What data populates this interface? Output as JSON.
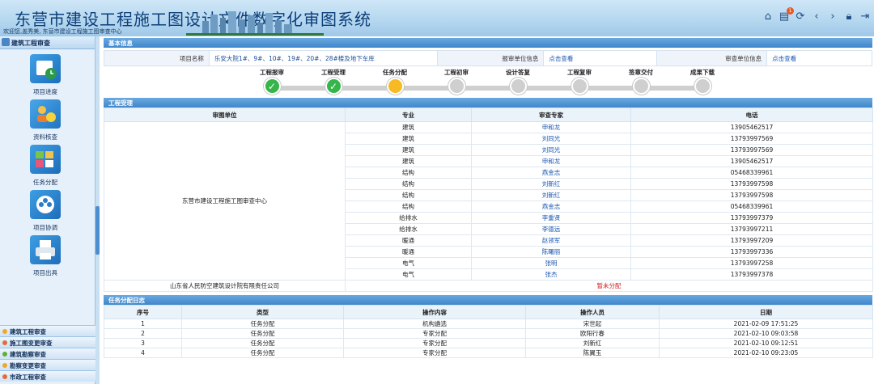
{
  "header": {
    "title": "东营市建设工程施工图设计文件数字化审图系统",
    "welcome": "欢迎您,盖秀美, 东营市建设工程施工图审查中心",
    "badge_count": "1"
  },
  "sidebar": {
    "head": "建筑工程审查",
    "items": [
      {
        "label": "项目进度",
        "icon": "calendar-clock-icon"
      },
      {
        "label": "资料核查",
        "icon": "people-check-icon"
      },
      {
        "label": "任务分配",
        "icon": "task-assign-icon"
      },
      {
        "label": "项目协调",
        "icon": "coordination-icon"
      },
      {
        "label": "项目出具",
        "icon": "printer-icon"
      }
    ],
    "bottom": [
      "建筑工程审查",
      "施工图变更审查",
      "建筑勘察审查",
      "勘察变更审查",
      "市政工程审查"
    ]
  },
  "basic": {
    "section": "基本信息",
    "project_name_label": "项目名称",
    "project_name": "乐安大院1#、9#、10#、19#、20#、28#楼及地下车库",
    "report_unit_label": "报审单位信息",
    "report_unit_link": "点击查看",
    "review_unit_label": "审查单位信息",
    "review_unit_link": "点击查看"
  },
  "steps": [
    {
      "name": "工程报审",
      "status": "done"
    },
    {
      "name": "工程受理",
      "status": "done"
    },
    {
      "name": "任务分配",
      "status": "current"
    },
    {
      "name": "工程初审",
      "status": "pending"
    },
    {
      "name": "设计答复",
      "status": "pending"
    },
    {
      "name": "工程复审",
      "status": "pending"
    },
    {
      "name": "签章交付",
      "status": "pending"
    },
    {
      "name": "成果下载",
      "status": "pending"
    }
  ],
  "acceptance": {
    "section": "工程受理",
    "headers": [
      "审图单位",
      "专业",
      "审查专家",
      "电话"
    ],
    "unit": "东营市建设工程施工图审查中心",
    "rows": [
      {
        "major": "建筑",
        "expert": "申和龙",
        "phone": "13905462517"
      },
      {
        "major": "建筑",
        "expert": "刘同光",
        "phone": "13793997569"
      },
      {
        "major": "建筑",
        "expert": "刘同光",
        "phone": "13793997569"
      },
      {
        "major": "建筑",
        "expert": "申和龙",
        "phone": "13905462517"
      },
      {
        "major": "结构",
        "expert": "燕金志",
        "phone": "05468339961"
      },
      {
        "major": "结构",
        "expert": "刘新红",
        "phone": "13793997598"
      },
      {
        "major": "结构",
        "expert": "刘新红",
        "phone": "13793997598"
      },
      {
        "major": "结构",
        "expert": "燕金志",
        "phone": "05468339961"
      },
      {
        "major": "给排水",
        "expert": "李重贤",
        "phone": "13793997379"
      },
      {
        "major": "给排水",
        "expert": "李德远",
        "phone": "13793997211"
      },
      {
        "major": "暖通",
        "expert": "赵领军",
        "phone": "13793997209"
      },
      {
        "major": "暖通",
        "expert": "陈曙丽",
        "phone": "13793997336"
      },
      {
        "major": "电气",
        "expert": "张明",
        "phone": "13793997258"
      },
      {
        "major": "电气",
        "expert": "张杰",
        "phone": "13793997378"
      }
    ],
    "other_unit": "山东省人民防空建筑设计院有限责任公司",
    "other_status": "暂未分配"
  },
  "log": {
    "section": "任务分配日志",
    "headers": [
      "序号",
      "类型",
      "操作内容",
      "操作人员",
      "日期"
    ],
    "rows": [
      {
        "no": "1",
        "type": "任务分配",
        "content": "机构遴选",
        "operator": "宋世起",
        "date": "2021-02-09 17:51:25"
      },
      {
        "no": "2",
        "type": "任务分配",
        "content": "专家分配",
        "operator": "欧阳行春",
        "date": "2021-02-10 09:03:58"
      },
      {
        "no": "3",
        "type": "任务分配",
        "content": "专家分配",
        "operator": "刘新红",
        "date": "2021-02-10 09:12:51"
      },
      {
        "no": "4",
        "type": "任务分配",
        "content": "专家分配",
        "operator": "陈翼玉",
        "date": "2021-02-10 09:23:05"
      }
    ]
  },
  "colors": {
    "done": "#35b54a",
    "current": "#f7b924",
    "pending": "#cfcfcf",
    "accent": "#3f86cb"
  }
}
